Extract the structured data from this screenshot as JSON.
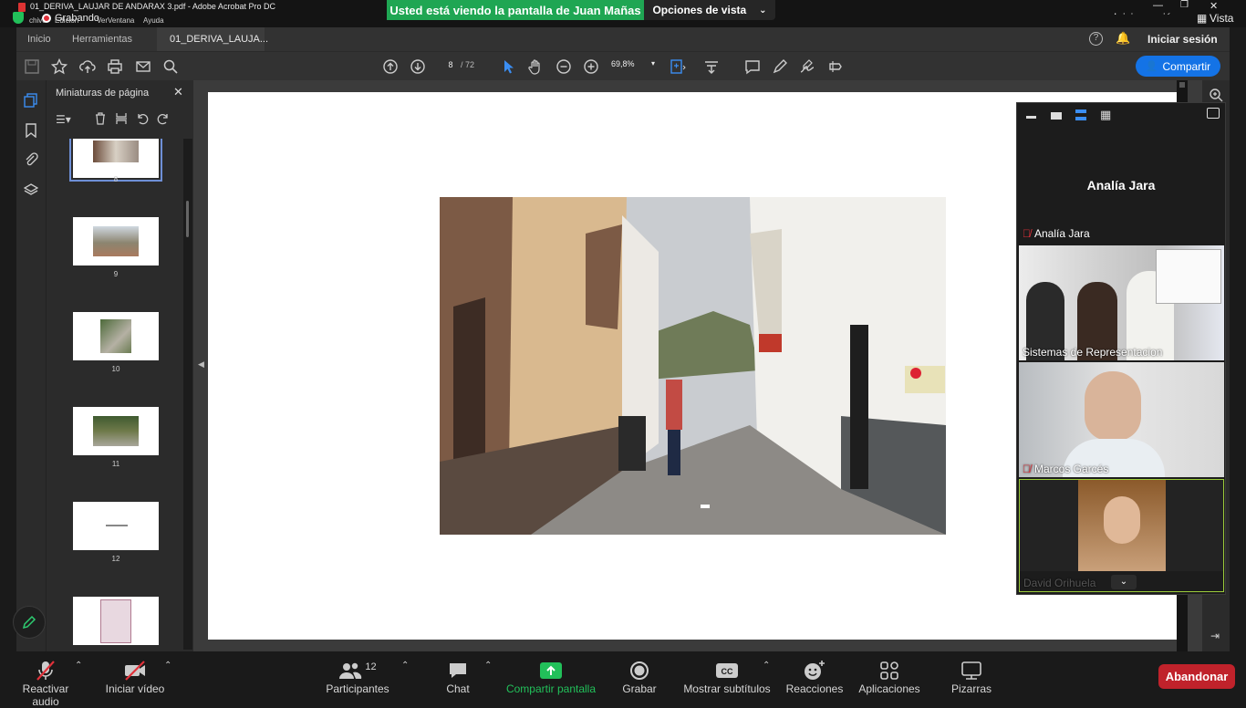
{
  "window": {
    "title": "01_DERIVA_LAUJAR DE ANDARAX 3.pdf - Adobe Acrobat Pro DC",
    "menu": [
      "chivo",
      "Edición",
      "Ver",
      "Ventana",
      "Ayuda"
    ],
    "recording_label": "Grabando",
    "top_right_signin": "Iniciar sesión",
    "top_right_view": "Vista"
  },
  "share_banner": {
    "message": "Usted está viendo la pantalla de Juan Mañas",
    "options_label": "Opciones de vista"
  },
  "acrobat": {
    "tabs": [
      "Inicio",
      "Herramientas",
      "01_DERIVA_LAUJA..."
    ],
    "signin_label": "Iniciar sesión",
    "page_current": "8",
    "page_total": "/ 72",
    "zoom": "69,8%",
    "share_button": "Compartir",
    "thumbnail_panel_title": "Miniaturas de página",
    "thumbnails": [
      {
        "num": "8"
      },
      {
        "num": "9"
      },
      {
        "num": "10"
      },
      {
        "num": "11"
      },
      {
        "num": "12"
      }
    ]
  },
  "video_panel": {
    "speaker_name": "Analía Jara",
    "participants": [
      {
        "name": "Analía Jara",
        "muted": true
      },
      {
        "name": "Sistemas de Representacion",
        "muted": false
      },
      {
        "name": "Marcos Garcés",
        "muted": true
      },
      {
        "name": "David Orihuela",
        "muted": false
      }
    ]
  },
  "zoom_bar": {
    "audio": "Reactivar audio",
    "video": "Iniciar vídeo",
    "participants": "Participantes",
    "participants_count": "12",
    "chat": "Chat",
    "share": "Compartir pantalla",
    "record": "Grabar",
    "subtitles": "Mostrar subtítulos",
    "reactions": "Reacciones",
    "apps": "Aplicaciones",
    "whiteboards": "Pizarras",
    "leave": "Abandonar",
    "colors": {
      "share_green": "#22c05a",
      "leave_red": "#c0222b",
      "mute_red": "#e0313a"
    }
  }
}
